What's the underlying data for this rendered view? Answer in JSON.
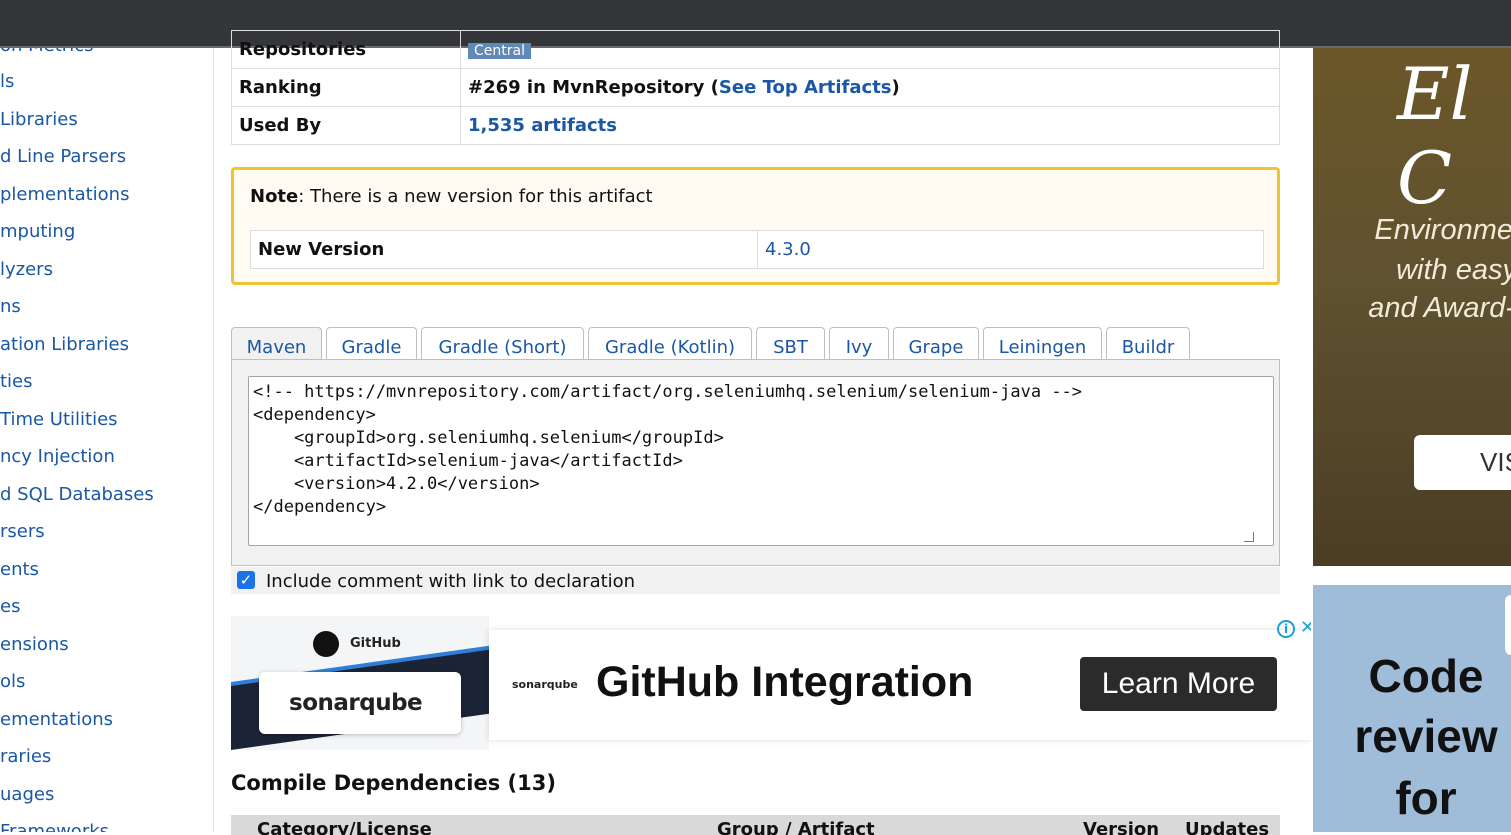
{
  "sidebar": {
    "items": [
      "on Metrics",
      "ls",
      " Libraries",
      "d Line Parsers",
      "plementations",
      "mputing",
      "lyzers",
      "ns",
      "ation Libraries",
      "ties",
      " Time Utilities",
      "ncy Injection",
      "d SQL Databases",
      "rsers",
      "ents",
      "es",
      "ensions",
      "ols",
      "ementations",
      "raries",
      "uages",
      "Frameworks"
    ]
  },
  "info": {
    "repositories_label": "Repositories",
    "repositories_value": "Central",
    "ranking_label": "Ranking",
    "ranking_prefix": "#269 in MvnRepository (",
    "ranking_link": "See Top Artifacts",
    "ranking_suffix": ")",
    "used_by_label": "Used By",
    "used_by_value": "1,535 artifacts"
  },
  "note": {
    "label": "Note",
    "text": ": There is a new version for this artifact",
    "new_version_label": "New Version",
    "new_version_value": "4.3.0"
  },
  "tabs": [
    "Maven",
    "Gradle",
    "Gradle (Short)",
    "Gradle (Kotlin)",
    "SBT",
    "Ivy",
    "Grape",
    "Leiningen",
    "Buildr"
  ],
  "code": "<!-- https://mvnrepository.com/artifact/org.seleniumhq.selenium/selenium-java -->\n<dependency>\n    <groupId>org.seleniumhq.selenium</groupId>\n    <artifactId>selenium-java</artifactId>\n    <version>4.2.0</version>\n</dependency>",
  "include_comment": {
    "checked": true,
    "label": "Include comment with link to declaration"
  },
  "ad": {
    "github_text": "GitHub",
    "sonarqube_logo": "sonarqube",
    "sonarqube_small": "sonarqube",
    "headline": "GitHub Integration",
    "cta": "Learn More",
    "info_icon": "i",
    "close_icon": "✕"
  },
  "compile_deps": {
    "title": "Compile Dependencies (13)",
    "headers": [
      "Category/License",
      "Group / Artifact",
      "Version",
      "Updates"
    ]
  },
  "right_ad1": {
    "logo": "El C",
    "line1": "Environme",
    "line2": "with easy",
    "line3": "and Award-",
    "button": "VIS"
  },
  "right_ad2": {
    "line1": "Code",
    "line2": "review",
    "line3": "for"
  },
  "colors": {
    "link": "#1a57a4",
    "note_border": "#f1c232",
    "topbar": "#35363a"
  }
}
